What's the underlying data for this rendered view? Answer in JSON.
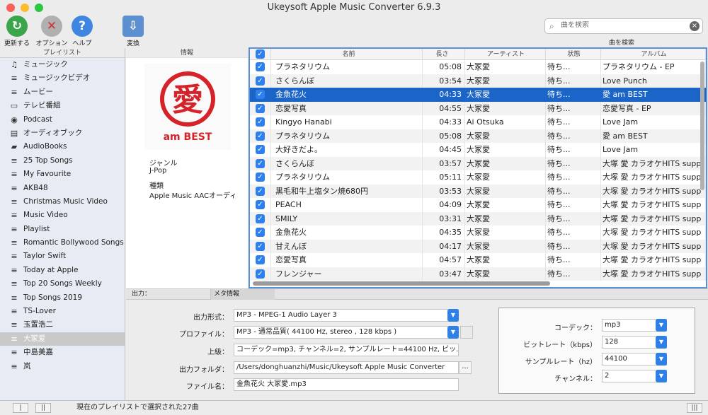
{
  "window": {
    "title": "Ukeysoft Apple Music Converter 6.9.3"
  },
  "toolbar": {
    "refresh_label": "更新する",
    "options_label": "オプション",
    "help_label": "ヘルプ",
    "convert_label": "変換",
    "search_placeholder": "曲を検索",
    "search_label": "曲を検索"
  },
  "sidebar": {
    "header": "プレイリスト",
    "items": [
      {
        "label": "ミュージック",
        "icon": "music-note-icon"
      },
      {
        "label": "ミュージックビデオ",
        "icon": "playlist-icon"
      },
      {
        "label": "ムービー",
        "icon": "playlist-icon"
      },
      {
        "label": "テレビ番組",
        "icon": "tv-icon"
      },
      {
        "label": "Podcast",
        "icon": "podcast-icon"
      },
      {
        "label": "オーディオブック",
        "icon": "book-icon"
      },
      {
        "label": "AudioBooks",
        "icon": "folder-icon"
      },
      {
        "label": "25 Top Songs",
        "icon": "playlist-icon"
      },
      {
        "label": "My Favourite",
        "icon": "playlist-icon"
      },
      {
        "label": "AKB48",
        "icon": "playlist-icon"
      },
      {
        "label": "Christmas Music Video",
        "icon": "playlist-icon"
      },
      {
        "label": "Music Video",
        "icon": "playlist-icon"
      },
      {
        "label": "Playlist",
        "icon": "playlist-icon"
      },
      {
        "label": "Romantic Bollywood Songs",
        "icon": "playlist-icon"
      },
      {
        "label": "Taylor Swift",
        "icon": "playlist-icon"
      },
      {
        "label": "Today at Apple",
        "icon": "playlist-icon"
      },
      {
        "label": "Top 20 Songs Weekly",
        "icon": "playlist-icon"
      },
      {
        "label": "Top Songs 2019",
        "icon": "playlist-icon"
      },
      {
        "label": "TS-Lover",
        "icon": "playlist-icon"
      },
      {
        "label": "玉置浩二",
        "icon": "playlist-icon"
      },
      {
        "label": "大冢爱",
        "icon": "playlist-icon",
        "selected": true
      },
      {
        "label": "中島美嘉",
        "icon": "playlist-icon"
      },
      {
        "label": "岚",
        "icon": "playlist-icon"
      }
    ]
  },
  "info": {
    "header": "情報",
    "art_text": "愛",
    "art_subtext": "am BEST",
    "genre_label": "ジャンル",
    "genre_value": "J-Pop",
    "kind_label": "種類",
    "kind_value": "Apple Music AACオーディ"
  },
  "table": {
    "columns": [
      "名前",
      "長さ",
      "アーティスト",
      "状態",
      "アルバム"
    ],
    "rows": [
      {
        "name": "プラネタリウム",
        "length": "05:08",
        "artist": "大冢愛",
        "status": "待ち...",
        "album": "プラネタリウム - EP"
      },
      {
        "name": "さくらんぼ",
        "length": "03:54",
        "artist": "大冢愛",
        "status": "待ち...",
        "album": "Love Punch"
      },
      {
        "name": "金魚花火",
        "length": "04:33",
        "artist": "大冢愛",
        "status": "待ち...",
        "album": "愛 am BEST",
        "selected": true
      },
      {
        "name": "恋愛写真",
        "length": "04:55",
        "artist": "大冢愛",
        "status": "待ち...",
        "album": "恋愛写真 - EP"
      },
      {
        "name": "Kingyo Hanabi",
        "length": "04:33",
        "artist": "Ai Otsuka",
        "status": "待ち...",
        "album": "Love Jam"
      },
      {
        "name": "プラネタリウム",
        "length": "05:08",
        "artist": "大冢愛",
        "status": "待ち...",
        "album": "愛 am BEST"
      },
      {
        "name": "大好きだよ。",
        "length": "04:45",
        "artist": "大冢愛",
        "status": "待ち...",
        "album": "Love Jam"
      },
      {
        "name": "さくらんぼ",
        "length": "03:57",
        "artist": "大冢愛",
        "status": "待ち...",
        "album": "大塚 愛 カラオケHITS supp"
      },
      {
        "name": "プラネタリウム",
        "length": "05:11",
        "artist": "大冢愛",
        "status": "待ち...",
        "album": "大塚 愛 カラオケHITS supp"
      },
      {
        "name": "黒毛和牛上塩タン焼680円",
        "length": "03:53",
        "artist": "大冢愛",
        "status": "待ち...",
        "album": "大塚 愛 カラオケHITS supp"
      },
      {
        "name": "PEACH",
        "length": "04:09",
        "artist": "大冢愛",
        "status": "待ち...",
        "album": "大塚 愛 カラオケHITS supp"
      },
      {
        "name": "SMILY",
        "length": "03:31",
        "artist": "大冢愛",
        "status": "待ち...",
        "album": "大塚 愛 カラオケHITS supp"
      },
      {
        "name": "金魚花火",
        "length": "04:35",
        "artist": "大冢愛",
        "status": "待ち...",
        "album": "大塚 愛 カラオケHITS supp"
      },
      {
        "name": "甘えんぼ",
        "length": "04:17",
        "artist": "大冢愛",
        "status": "待ち...",
        "album": "大塚 愛 カラオケHITS supp"
      },
      {
        "name": "恋愛写真",
        "length": "04:57",
        "artist": "大冢愛",
        "status": "待ち...",
        "album": "大塚 愛 カラオケHITS supp"
      },
      {
        "name": "フレンジャー",
        "length": "03:47",
        "artist": "大冢愛",
        "status": "待ち...",
        "album": "大塚 愛 カラオケHITS supp"
      }
    ]
  },
  "tabs": {
    "output": "出力：",
    "meta": "メタ情報"
  },
  "settings": {
    "format_label": "出力形式：",
    "format_value": "MP3 - MPEG-1 Audio Layer 3",
    "profile_label": "プロファイル：",
    "profile_value": "MP3 - 通常品質( 44100 Hz, stereo , 128 kbps )",
    "advanced_label": "上級：",
    "advanced_value": "コーデック=mp3, チャンネル=2, サンプルレート=44100 Hz, ビッ...",
    "folder_label": "出力フォルダ：",
    "folder_value": "/Users/donghuanzhi/Music/Ukeysoft Apple Music Converter",
    "browse_label": "...",
    "filename_label": "ファイル名：",
    "filename_value": "金魚花火 大冢愛.mp3",
    "codec_label": "コーデック：",
    "codec_value": "mp3",
    "bitrate_label": "ビットレート（kbps）",
    "bitrate_value": "128",
    "samplerate_label": "サンプルレート（hz）",
    "samplerate_value": "44100",
    "channel_label": "チャンネル：",
    "channel_value": "2"
  },
  "status": {
    "text": "現在のプレイリストで選択された27曲"
  }
}
